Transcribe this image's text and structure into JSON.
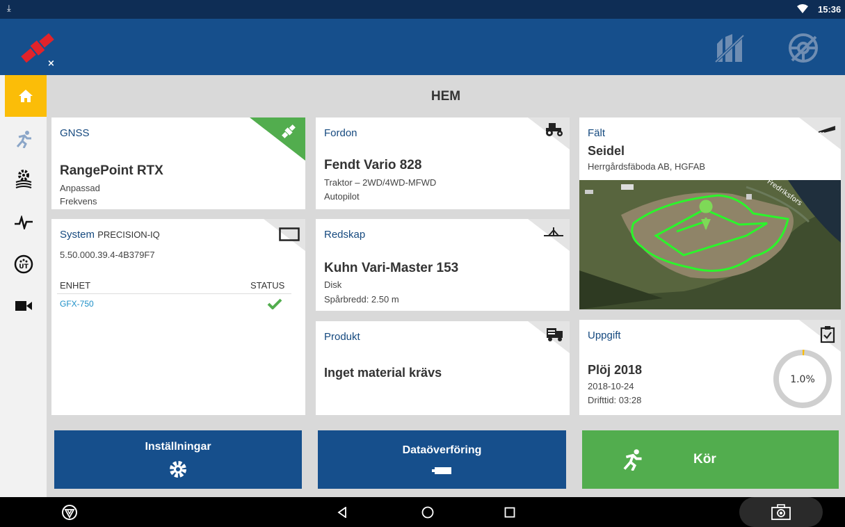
{
  "status_bar": {
    "time": "15:36"
  },
  "page": {
    "title": "HEM"
  },
  "gnss": {
    "header": "GNSS",
    "receiver": "RangePoint RTX",
    "line1": "Anpassad",
    "line2": "Frekvens"
  },
  "system": {
    "header": "System",
    "product": "PRECISION-IQ",
    "version": "5.50.000.39.4-4B379F7",
    "col_unit": "ENHET",
    "col_status": "STATUS",
    "rows": [
      {
        "unit": "GFX-750",
        "status": "ok"
      }
    ]
  },
  "vehicle": {
    "header": "Fordon",
    "name": "Fendt Vario 828",
    "line1": "Traktor – 2WD/4WD-MFWD",
    "line2": "Autopilot"
  },
  "implement": {
    "header": "Redskap",
    "name": "Kuhn Vari-Master 153",
    "line1": "Disk",
    "line2": "Spårbredd: 2.50 m"
  },
  "product": {
    "header": "Produkt",
    "name": "Inget material krävs"
  },
  "field": {
    "header": "Fält",
    "name": "Seidel",
    "owner": "Herrgårdsfäboda AB, HGFAB",
    "map_label": "Fredriksfors"
  },
  "task": {
    "header": "Uppgift",
    "name": "Plöj 2018",
    "date": "2018-10-24",
    "runtime": "Drifttid: 03:28",
    "progress_label": "1.0%",
    "progress": 0.01
  },
  "buttons": {
    "settings": "Inställningar",
    "transfer": "Dataöverföring",
    "run": "Kör"
  },
  "colors": {
    "primary": "#164f8c",
    "status_bar": "#0e2d55",
    "accent": "#fbbd08",
    "success": "#52ad4e",
    "link": "#1d8fc7"
  }
}
